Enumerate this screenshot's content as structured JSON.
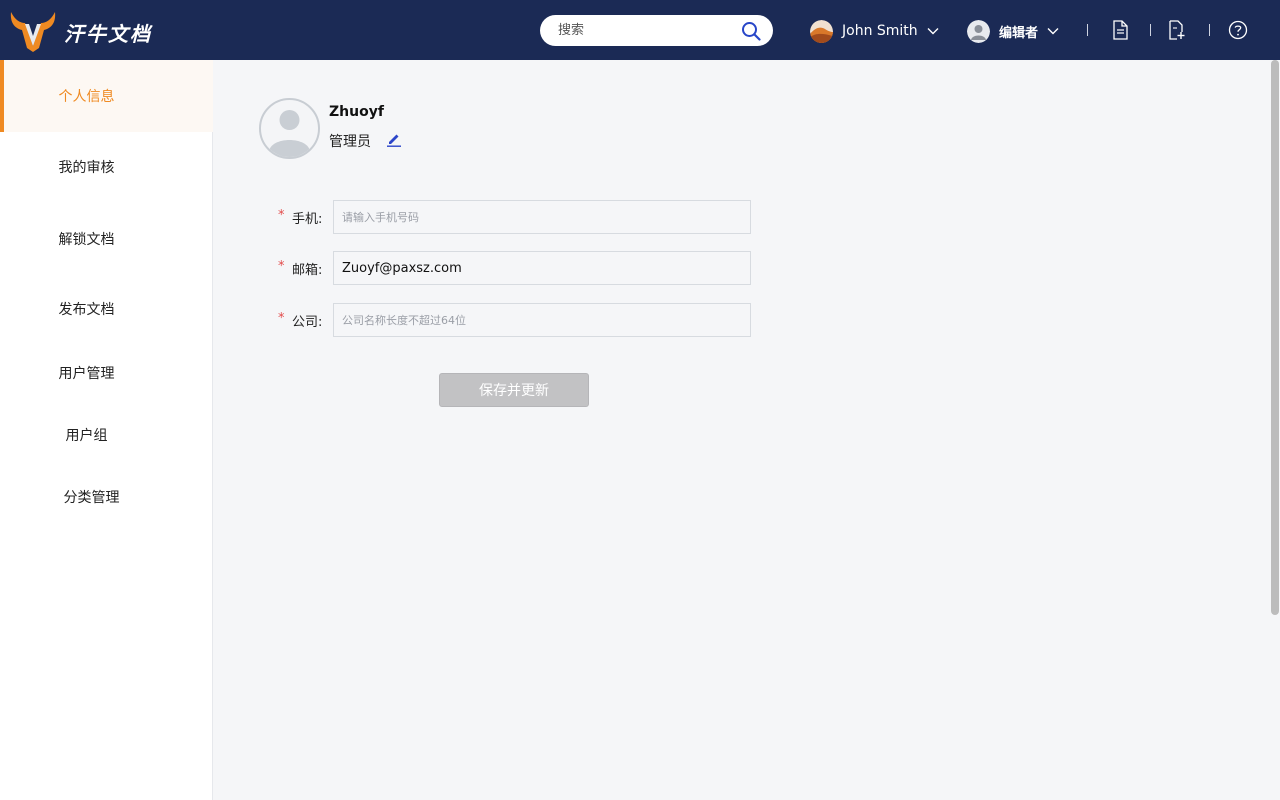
{
  "header": {
    "brand": "汗牛文档",
    "search_placeholder": "搜索",
    "user_name": "John Smith",
    "role_label": "编辑者"
  },
  "sidebar": {
    "items": [
      {
        "label": "个人信息",
        "active": true
      },
      {
        "label": "我的审核",
        "active": false
      },
      {
        "label": "解锁文档",
        "active": false
      },
      {
        "label": "发布文档",
        "active": false
      },
      {
        "label": "用户管理",
        "active": false
      },
      {
        "label": "用户组",
        "active": false
      },
      {
        "label": "分类管理",
        "active": false
      }
    ]
  },
  "profile": {
    "name": "Zhuoyf",
    "role": "管理员"
  },
  "form": {
    "required_mark": "*",
    "phone_label": "手机:",
    "phone_value": "",
    "phone_placeholder": "请输入手机号码",
    "email_label": "邮箱:",
    "email_value": "Zuoyf@paxsz.com",
    "email_placeholder": "",
    "company_label": "公司:",
    "company_value": "",
    "company_placeholder": "公司名称长度不超过64位",
    "save_label": "保存并更新"
  },
  "colors": {
    "header_bg": "#1b2a55",
    "accent": "#ef8a22",
    "required": "#e24a4a",
    "button_disabled": "#c2c2c4"
  }
}
